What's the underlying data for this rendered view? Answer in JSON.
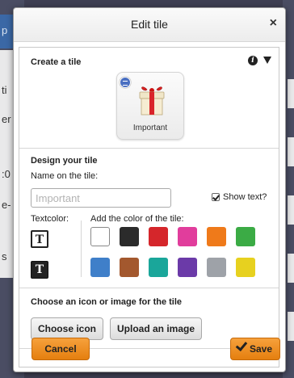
{
  "background": {
    "fragments": [
      "p",
      "ti",
      "er",
      ":0",
      "e-",
      "s"
    ]
  },
  "dialog": {
    "title": "Edit tile",
    "close_glyph": "×"
  },
  "create": {
    "heading": "Create a tile",
    "info_icon": "info-icon",
    "collapse_icon": "triangle-down-icon",
    "tile_label": "Important",
    "tile_icon": "gift-icon"
  },
  "design": {
    "heading": "Design your tile",
    "name_label": "Name on the tile:",
    "name_placeholder": "Important",
    "show_text_label": "Show text?",
    "show_text_checked": true,
    "textcolor_label": "Textcolor:",
    "textcolor_glyph_light": "T",
    "textcolor_glyph_dark": "T",
    "color_label": "Add the color of the tile:",
    "colors": [
      "#ffffff",
      "#2b2b2b",
      "#d5262b",
      "#e13d9c",
      "#ef7a1a",
      "#3bab45",
      "#3f7fc9",
      "#a3582e",
      "#1aa69a",
      "#6b3aa8",
      "#9ea2a8",
      "#e7d11f"
    ],
    "selected_color_index": 0
  },
  "icon_section": {
    "heading": "Choose an icon or image for the tile",
    "choose_icon": "Choose icon",
    "upload_image": "Upload an image"
  },
  "footer": {
    "cancel": "Cancel",
    "save": "Save",
    "save_icon": "checkmark-icon"
  }
}
